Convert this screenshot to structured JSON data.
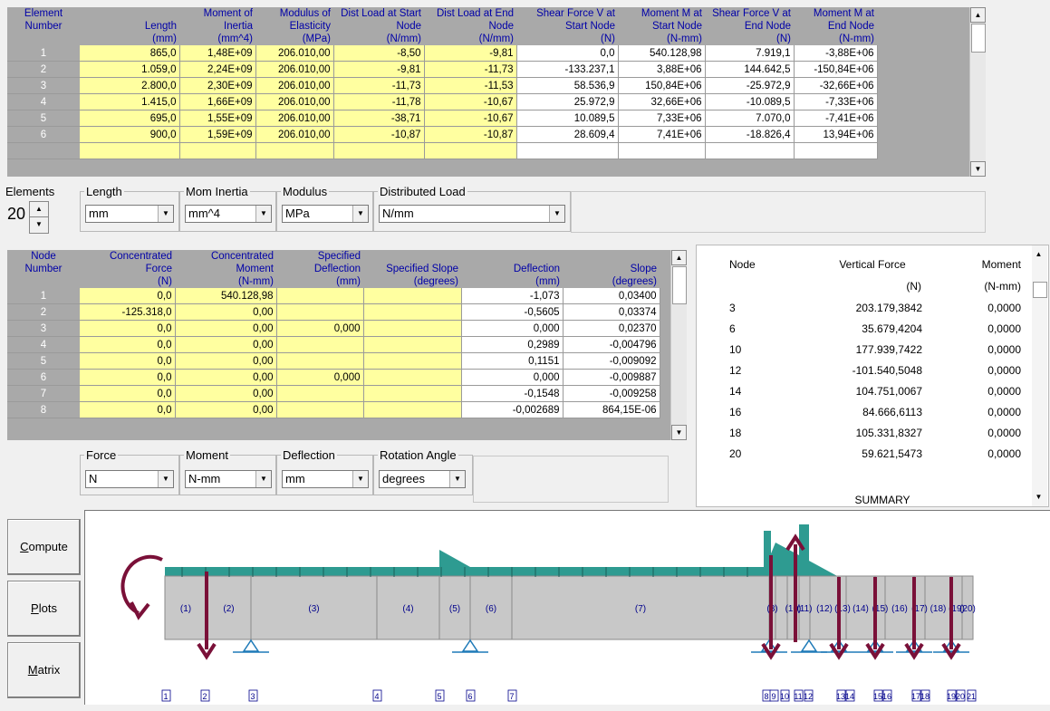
{
  "element_table": {
    "header_lines": [
      [
        "Element",
        "",
        "Moment of",
        "Modulus of",
        "Dist Load at Start",
        "Dist Load at End",
        "Shear Force V at",
        "Moment M at",
        "Shear Force V at",
        "Moment M at"
      ],
      [
        "Number",
        "Length",
        "Inertia",
        "Elasticity",
        "Node",
        "Node",
        "Start Node",
        "Start Node",
        "End Node",
        "End Node"
      ],
      [
        "",
        "(mm)",
        "(mm^4)",
        "(MPa)",
        "(N/mm)",
        "(N/mm)",
        "(N)",
        "(N-mm)",
        "(N)",
        "(N-mm)"
      ]
    ],
    "rows": [
      [
        "1",
        "865,0",
        "1,48E+09",
        "206.010,00",
        "-8,50",
        "-9,81",
        "0,0",
        "540.128,98",
        "7.919,1",
        "-3,88E+06"
      ],
      [
        "2",
        "1.059,0",
        "2,24E+09",
        "206.010,00",
        "-9,81",
        "-11,73",
        "-133.237,1",
        "3,88E+06",
        "144.642,5",
        "-150,84E+06"
      ],
      [
        "3",
        "2.800,0",
        "2,30E+09",
        "206.010,00",
        "-11,73",
        "-11,53",
        "58.536,9",
        "150,84E+06",
        "-25.972,9",
        "-32,66E+06"
      ],
      [
        "4",
        "1.415,0",
        "1,66E+09",
        "206.010,00",
        "-11,78",
        "-10,67",
        "25.972,9",
        "32,66E+06",
        "-10.089,5",
        "-7,33E+06"
      ],
      [
        "5",
        "695,0",
        "1,55E+09",
        "206.010,00",
        "-38,71",
        "-10,67",
        "10.089,5",
        "7,33E+06",
        "7.070,0",
        "-7,41E+06"
      ],
      [
        "6",
        "900,0",
        "1,59E+09",
        "206.010,00",
        "-10,87",
        "-10,87",
        "28.609,4",
        "7,41E+06",
        "-18.826,4",
        "13,94E+06"
      ]
    ]
  },
  "element_units": {
    "elements_label": "Elements",
    "elements_value": "20",
    "length_label": "Length",
    "length_value": "mm",
    "inertia_label": "Mom Inertia",
    "inertia_value": "mm^4",
    "modulus_label": "Modulus",
    "modulus_value": "MPa",
    "dload_label": "Distributed Load",
    "dload_value": "N/mm"
  },
  "node_table": {
    "header_lines": [
      [
        "Node",
        "Concentrated",
        "Concentrated",
        "Specified",
        "",
        "",
        ""
      ],
      [
        "Number",
        "Force",
        "Moment",
        "Deflection",
        "Specified Slope",
        "Deflection",
        "Slope"
      ],
      [
        "",
        "(N)",
        "(N-mm)",
        "(mm)",
        "(degrees)",
        "(mm)",
        "(degrees)"
      ]
    ],
    "rows": [
      [
        "1",
        "0,0",
        "540.128,98",
        "",
        "",
        "-1,073",
        "0,03400"
      ],
      [
        "2",
        "-125.318,0",
        "0,00",
        "",
        "",
        "-0,5605",
        "0,03374"
      ],
      [
        "3",
        "0,0",
        "0,00",
        "0,000",
        "",
        "0,000",
        "0,02370"
      ],
      [
        "4",
        "0,0",
        "0,00",
        "",
        "",
        "0,2989",
        "-0,004796"
      ],
      [
        "5",
        "0,0",
        "0,00",
        "",
        "",
        "0,1151",
        "-0,009092"
      ],
      [
        "6",
        "0,0",
        "0,00",
        "0,000",
        "",
        "0,000",
        "-0,009887"
      ],
      [
        "7",
        "0,0",
        "0,00",
        "",
        "",
        "-0,1548",
        "-0,009258"
      ],
      [
        "8",
        "0,0",
        "0,00",
        "",
        "",
        "-0,002689",
        "864,15E-06"
      ]
    ]
  },
  "node_units": {
    "force_label": "Force",
    "force_value": "N",
    "moment_label": "Moment",
    "moment_value": "N-mm",
    "deflection_label": "Deflection",
    "deflection_value": "mm",
    "rotation_label": "Rotation Angle",
    "rotation_value": "degrees"
  },
  "summary": {
    "col_node": "Node",
    "col_force": "Vertical Force",
    "col_moment": "Moment",
    "unit_force": "(N)",
    "unit_moment": "(N-mm)",
    "rows": [
      [
        "3",
        "203.179,3842",
        "0,0000"
      ],
      [
        "6",
        "35.679,4204",
        "0,0000"
      ],
      [
        "10",
        "177.939,7422",
        "0,0000"
      ],
      [
        "12",
        "-101.540,5048",
        "0,0000"
      ],
      [
        "14",
        "104.751,0067",
        "0,0000"
      ],
      [
        "16",
        "84.666,6113",
        "0,0000"
      ],
      [
        "18",
        "105.331,8327",
        "0,0000"
      ],
      [
        "20",
        "59.621,5473",
        "0,0000"
      ]
    ],
    "footer": "SUMMARY"
  },
  "buttons": {
    "compute": {
      "hotkey": "C",
      "rest": "ompute"
    },
    "plots": {
      "hotkey": "P",
      "rest": "lots"
    },
    "matrix": {
      "hotkey": "M",
      "rest": "atrix"
    }
  },
  "beam": {
    "element_labels": [
      "(1)",
      "(2)",
      "(3)",
      "(4)",
      "(5)",
      "(6)",
      "(7)",
      "(8)",
      "(10)",
      "(11)",
      "(12)",
      "(13)",
      "(14)",
      "(15)",
      "(16)",
      "(17)",
      "(18)",
      "(19)",
      "(20)"
    ],
    "node_labels": [
      "1",
      "2",
      "3",
      "4",
      "5",
      "6",
      "7",
      "8",
      "9",
      "10",
      "11",
      "12",
      "13",
      "14",
      "15",
      "16",
      "17",
      "18",
      "19",
      "20",
      "21"
    ],
    "colors": {
      "load": "#2e9b91",
      "arrow": "#7a1038",
      "beam": "#c8c8c8",
      "support": "#1e7ab8",
      "label": "#00008b"
    }
  }
}
